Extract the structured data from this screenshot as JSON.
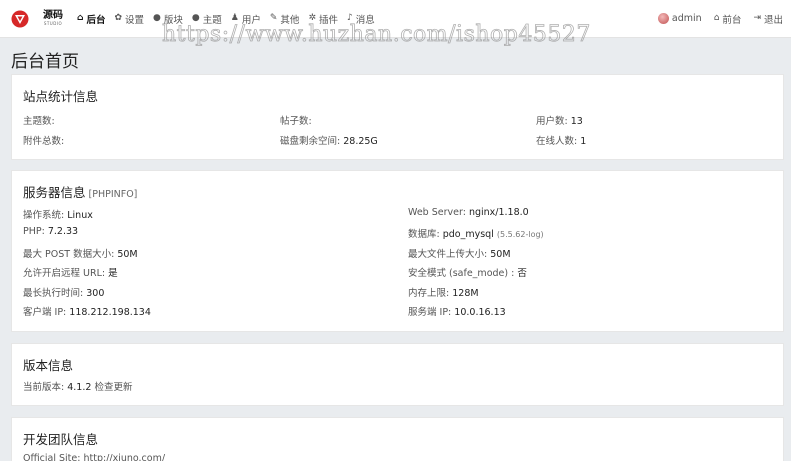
{
  "brand": {
    "name": "源码",
    "sub": "STUDIO"
  },
  "watermark": "https://www.huzhan.com/ishop45527",
  "nav": {
    "items": [
      {
        "icon": "home-icon",
        "glyph": "⌂",
        "label": "后台"
      },
      {
        "icon": "gear-icon",
        "glyph": "✿",
        "label": "设置"
      },
      {
        "icon": "comment-icon",
        "glyph": "●",
        "label": "版块"
      },
      {
        "icon": "comments-icon",
        "glyph": "●",
        "label": "主题"
      },
      {
        "icon": "user-icon",
        "glyph": "♟",
        "label": "用户"
      },
      {
        "icon": "wrench-icon",
        "glyph": "✎",
        "label": "其他"
      },
      {
        "icon": "plugin-icon",
        "glyph": "✲",
        "label": "插件"
      },
      {
        "icon": "bell-icon",
        "glyph": "♪",
        "label": "消息"
      }
    ],
    "right": {
      "user": "admin",
      "front": "前台",
      "logout": "退出",
      "front_glyph": "⌂",
      "logout_glyph": "⇥"
    }
  },
  "page_title": "后台首页",
  "site_stats": {
    "title": "站点统计信息",
    "rows": [
      {
        "label": "主题数:",
        "value": ""
      },
      {
        "label": "帖子数:",
        "value": ""
      },
      {
        "label": "用户数:",
        "value": "13"
      },
      {
        "label": "附件总数:",
        "value": ""
      },
      {
        "label": "磁盘剩余空间:",
        "value": "28.25G"
      },
      {
        "label": "在线人数:",
        "value": "1"
      }
    ]
  },
  "server_info": {
    "title": "服务器信息",
    "subtitle": "[PHPINFO]",
    "left": [
      {
        "label": "操作系统:",
        "value": "Linux"
      },
      {
        "label": "PHP:",
        "value": "7.2.33"
      },
      {
        "label": "最大 POST 数据大小:",
        "value": "50M"
      },
      {
        "label": "允许开启远程 URL:",
        "value": "是"
      },
      {
        "label": "最长执行时间:",
        "value": "300"
      },
      {
        "label": "客户端 IP:",
        "value": "118.212.198.134"
      }
    ],
    "right": [
      {
        "label": "Web Server:",
        "value": "nginx/1.18.0",
        "extra": ""
      },
      {
        "label": "数据库:",
        "value": "pdo_mysql",
        "extra": "(5.5.62-log)"
      },
      {
        "label": "最大文件上传大小:",
        "value": "50M",
        "extra": ""
      },
      {
        "label": "安全模式 (safe_mode) :",
        "value": "否",
        "extra": ""
      },
      {
        "label": "内存上限:",
        "value": "128M",
        "extra": ""
      },
      {
        "label": "服务端 IP:",
        "value": "10.0.16.13",
        "extra": ""
      }
    ]
  },
  "version_info": {
    "title": "版本信息",
    "label": "当前版本:",
    "value": "4.1.2",
    "check_link": "检查更新"
  },
  "dev_team": {
    "title": "开发团队信息",
    "official_label": "Official Site:",
    "official_value": "http://xiuno.com/"
  }
}
